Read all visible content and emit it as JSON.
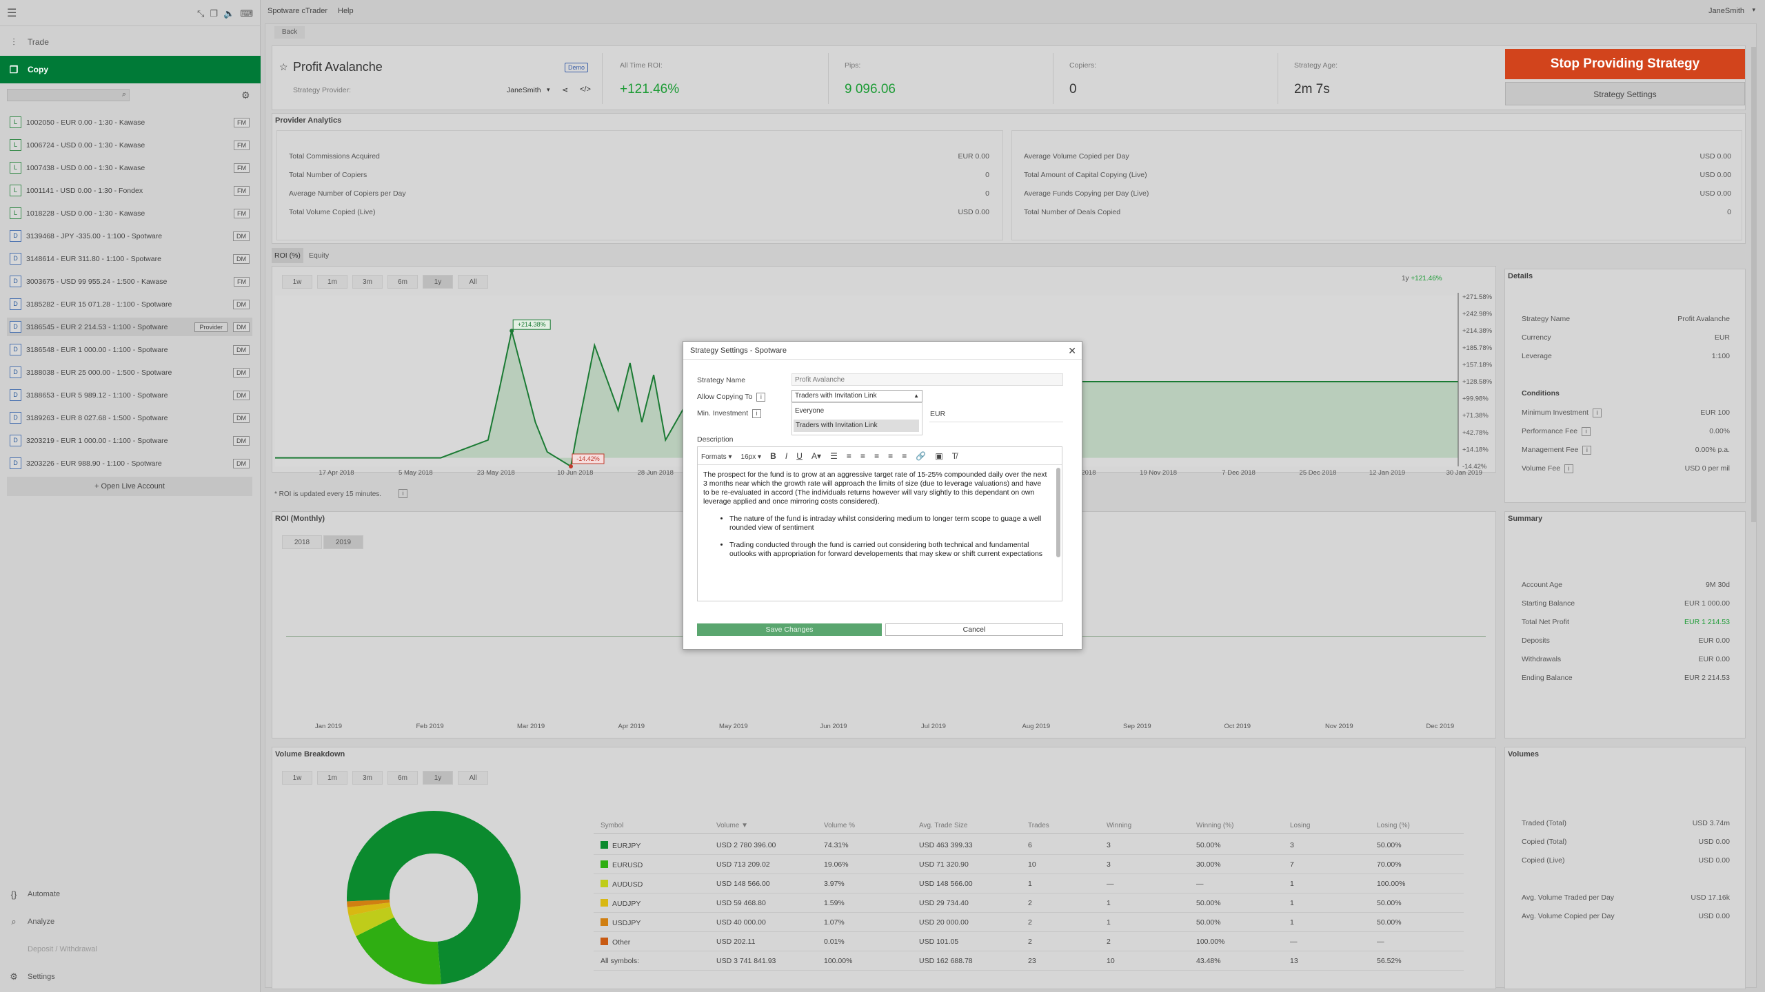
{
  "app": {
    "title": "Spotware cTrader",
    "help": "Help",
    "user": "JaneSmith"
  },
  "nav": {
    "trade": "Trade",
    "copy": "Copy",
    "automate": "Automate",
    "analyze": "Analyze",
    "deposit": "Deposit / Withdrawal",
    "settings": "Settings",
    "open_live": "+ Open Live Account"
  },
  "accounts": [
    {
      "badge": "L",
      "text": "1002050 - EUR 0.00 - 1:30 - Kawase",
      "tag": "FM"
    },
    {
      "badge": "L",
      "text": "1006724 - USD 0.00 - 1:30 - Kawase",
      "tag": "FM"
    },
    {
      "badge": "L",
      "text": "1007438 - USD 0.00 - 1:30 - Kawase",
      "tag": "FM"
    },
    {
      "badge": "L",
      "text": "1001141 - USD 0.00 - 1:30 - Fondex",
      "tag": "FM"
    },
    {
      "badge": "L",
      "text": "1018228 - USD 0.00 - 1:30 - Kawase",
      "tag": "FM"
    },
    {
      "badge": "D",
      "text": "3139468 - JPY -335.00 - 1:100 - Spotware",
      "tag": "DM"
    },
    {
      "badge": "D",
      "text": "3148614 - EUR 311.80 - 1:100 - Spotware",
      "tag": "DM"
    },
    {
      "badge": "D",
      "text": "3003675 - USD 99 955.24 - 1:500 - Kawase",
      "tag": "FM"
    },
    {
      "badge": "D",
      "text": "3185282 - EUR 15 071.28 - 1:100 - Spotware",
      "tag": "DM"
    },
    {
      "badge": "D",
      "text": "3186545 - EUR 2 214.53 - 1:100 - Spotware",
      "tag": "DM",
      "extra": "Provider"
    },
    {
      "badge": "D",
      "text": "3186548 - EUR 1 000.00 - 1:100 - Spotware",
      "tag": "DM"
    },
    {
      "badge": "D",
      "text": "3188038 - EUR 25 000.00 - 1:500 - Spotware",
      "tag": "DM"
    },
    {
      "badge": "D",
      "text": "3188653 - EUR 5 989.12 - 1:100 - Spotware",
      "tag": "DM"
    },
    {
      "badge": "D",
      "text": "3189263 - EUR 8 027.68 - 1:500 - Spotware",
      "tag": "DM"
    },
    {
      "badge": "D",
      "text": "3203219 - EUR 1 000.00 - 1:100 - Spotware",
      "tag": "DM"
    },
    {
      "badge": "D",
      "text": "3203226 - EUR 988.90 - 1:100 - Spotware",
      "tag": "DM"
    }
  ],
  "strategy": {
    "back": "Back",
    "name": "Profit Avalanche",
    "demo": "Demo",
    "provider_label": "Strategy Provider:",
    "provider": "JaneSmith",
    "roi_label": "All Time ROI:",
    "roi": "+121.46%",
    "pips_label": "Pips:",
    "pips": "9 096.06",
    "copiers_label": "Copiers:",
    "copiers": "0",
    "age_label": "Strategy Age:",
    "age": "2m 7s",
    "stop_btn": "Stop Providing Strategy",
    "settings_btn": "Strategy Settings"
  },
  "analytics": {
    "title": "Provider Analytics",
    "left": [
      [
        "Total Commissions Acquired",
        "EUR 0.00"
      ],
      [
        "Total Number of Copiers",
        "0"
      ],
      [
        "Average Number of Copiers per Day",
        "0"
      ],
      [
        "Total Volume Copied (Live)",
        "USD 0.00"
      ]
    ],
    "right": [
      [
        "Average Volume Copied per Day",
        "USD 0.00"
      ],
      [
        "Total Amount of Capital Copying (Live)",
        "USD 0.00"
      ],
      [
        "Average Funds Copying per Day (Live)",
        "USD 0.00"
      ],
      [
        "Total Number of Deals Copied",
        "0"
      ]
    ]
  },
  "roi_chart": {
    "tab1": "ROI (%)",
    "tab2": "Equity",
    "ranges": [
      "1w",
      "1m",
      "3m",
      "6m",
      "1y",
      "All"
    ],
    "legend": "1y",
    "legend_val": "+121.46%",
    "note": "* ROI is updated every 15 minutes.",
    "y_ticks": [
      "+271.58%",
      "+242.98%",
      "+214.38%",
      "+185.78%",
      "+157.18%",
      "+128.58%",
      "+99.98%",
      "+71.38%",
      "+42.78%",
      "+14.18%",
      "-14.42%"
    ],
    "x_ticks": [
      "17 Apr 2018",
      "5 May 2018",
      "23 May 2018",
      "10 Jun 2018",
      "28 Jun 2018",
      "16",
      "1 Nov 2018",
      "19 Nov 2018",
      "7 Dec 2018",
      "25 Dec 2018",
      "12 Jan 2019",
      "30 Jan 2019"
    ],
    "max_label": "+214.38%",
    "min_label": "-14.42%"
  },
  "chart_data": {
    "type": "area",
    "ylim": [
      -14.42,
      271.58
    ],
    "x": [
      0,
      0.08,
      0.14,
      0.18,
      0.19,
      0.2,
      0.22,
      0.23,
      0.25,
      0.255,
      0.27,
      0.29,
      0.3,
      0.31,
      0.32,
      0.33,
      0.35,
      0.36,
      0.38,
      0.4,
      0.42,
      0.44,
      0.46,
      1
    ],
    "values": [
      0,
      0,
      0,
      30,
      120,
      214.38,
      60,
      10,
      -14.42,
      40,
      190,
      80,
      160,
      60,
      140,
      30,
      100,
      60,
      120,
      70,
      128.58,
      128.58,
      128.58,
      128.58
    ]
  },
  "details": {
    "title": "Details",
    "rows": [
      [
        "Strategy Name",
        "Profit Avalanche"
      ],
      [
        "Currency",
        "EUR"
      ],
      [
        "Leverage",
        "1:100"
      ]
    ],
    "conditions": "Conditions",
    "cond": [
      [
        "Minimum Investment",
        "EUR 100"
      ],
      [
        "Performance Fee",
        "0.00%"
      ],
      [
        "Management Fee",
        "0.00% p.a."
      ],
      [
        "Volume Fee",
        "USD 0 per mil"
      ]
    ]
  },
  "monthly": {
    "title": "ROI (Monthly)",
    "years": [
      "2018",
      "2019"
    ],
    "months": [
      "Jan 2019",
      "Feb 2019",
      "Mar 2019",
      "Apr 2019",
      "May 2019",
      "Jun 2019",
      "Jul 2019",
      "Aug 2019",
      "Sep 2019",
      "Oct 2019",
      "Nov 2019",
      "Dec 2019"
    ]
  },
  "summary": {
    "title": "Summary",
    "rows": [
      [
        "Account Age",
        "9M 30d"
      ],
      [
        "Starting Balance",
        "EUR 1 000.00"
      ],
      [
        "Total Net Profit",
        "EUR 1 214.53"
      ],
      [
        "Deposits",
        "EUR 0.00"
      ],
      [
        "Withdrawals",
        "EUR 0.00"
      ],
      [
        "Ending Balance",
        "EUR 2 214.53"
      ]
    ]
  },
  "volume": {
    "title": "Volume Breakdown",
    "ranges": [
      "1w",
      "1m",
      "3m",
      "6m",
      "1y",
      "All"
    ],
    "headers": [
      "Symbol",
      "Volume ▼",
      "Volume %",
      "Avg. Trade Size",
      "Trades",
      "Winning",
      "Winning (%)",
      "Losing",
      "Losing (%)"
    ],
    "rows": [
      {
        "c": "#0b8a2e",
        "v": [
          "EURJPY",
          "USD 2 780 396.00",
          "74.31%",
          "USD 463 399.33",
          "6",
          "3",
          "50.00%",
          "3",
          "50.00%"
        ]
      },
      {
        "c": "#2fae12",
        "v": [
          "EURUSD",
          "USD 713 209.02",
          "19.06%",
          "USD 71 320.90",
          "10",
          "3",
          "30.00%",
          "7",
          "70.00%"
        ]
      },
      {
        "c": "#bfcc1a",
        "v": [
          "AUDUSD",
          "USD 148 566.00",
          "3.97%",
          "USD 148 566.00",
          "1",
          "—",
          "—",
          "1",
          "100.00%"
        ]
      },
      {
        "c": "#d8b812",
        "v": [
          "AUDJPY",
          "USD 59 468.80",
          "1.59%",
          "USD 29 734.40",
          "2",
          "1",
          "50.00%",
          "1",
          "50.00%"
        ]
      },
      {
        "c": "#d07f12",
        "v": [
          "USDJPY",
          "USD 40 000.00",
          "1.07%",
          "USD 20 000.00",
          "2",
          "1",
          "50.00%",
          "1",
          "50.00%"
        ]
      },
      {
        "c": "#c85a12",
        "v": [
          "Other",
          "USD 202.11",
          "0.01%",
          "USD 101.05",
          "2",
          "2",
          "100.00%",
          "—",
          "—"
        ]
      },
      {
        "c": "",
        "v": [
          "All symbols:",
          "USD 3 741 841.93",
          "100.00%",
          "USD 162 688.78",
          "23",
          "10",
          "43.48%",
          "13",
          "56.52%"
        ]
      }
    ]
  },
  "volumes": {
    "title": "Volumes",
    "rows": [
      [
        "Traded (Total)",
        "USD 3.74m"
      ],
      [
        "Copied (Total)",
        "USD 0.00"
      ],
      [
        "Copied (Live)",
        "USD 0.00"
      ],
      [
        "Avg. Volume Traded per Day",
        "USD 17.16k"
      ],
      [
        "Avg. Volume Copied per Day",
        "USD 0.00"
      ]
    ]
  },
  "modal": {
    "title": "Strategy Settings - Spotware",
    "name_label": "Strategy Name",
    "name_placeholder": "Profit Avalanche",
    "allow_label": "Allow Copying To",
    "allow_value": "Traders with Invitation Link",
    "opt1": "Everyone",
    "opt2": "Traders with Invitation Link",
    "min_label": "Min. Investment",
    "currency": "EUR",
    "desc_label": "Description",
    "formats": "Formats",
    "size": "16px",
    "p1": "The prospect for the fund is to grow at an aggressive target rate of 15-25% compounded daily over the next 3 months near which the growth rate will approach the limits of size (due to leverage valuations) and have to be re-evaluated in accord (The individuals returns however will vary slightly to this dependant on own leverage applied and once mirroring costs considered).",
    "li1": "The nature of the fund is intraday whilst considering medium to longer term scope to guage a well rounded view of sentiment",
    "li2": "Trading conducted through the fund is carried out considering both technical and fundamental outlooks with appropriation for forward developements that may skew or shift current expectations",
    "save": "Save Changes",
    "cancel": "Cancel"
  }
}
